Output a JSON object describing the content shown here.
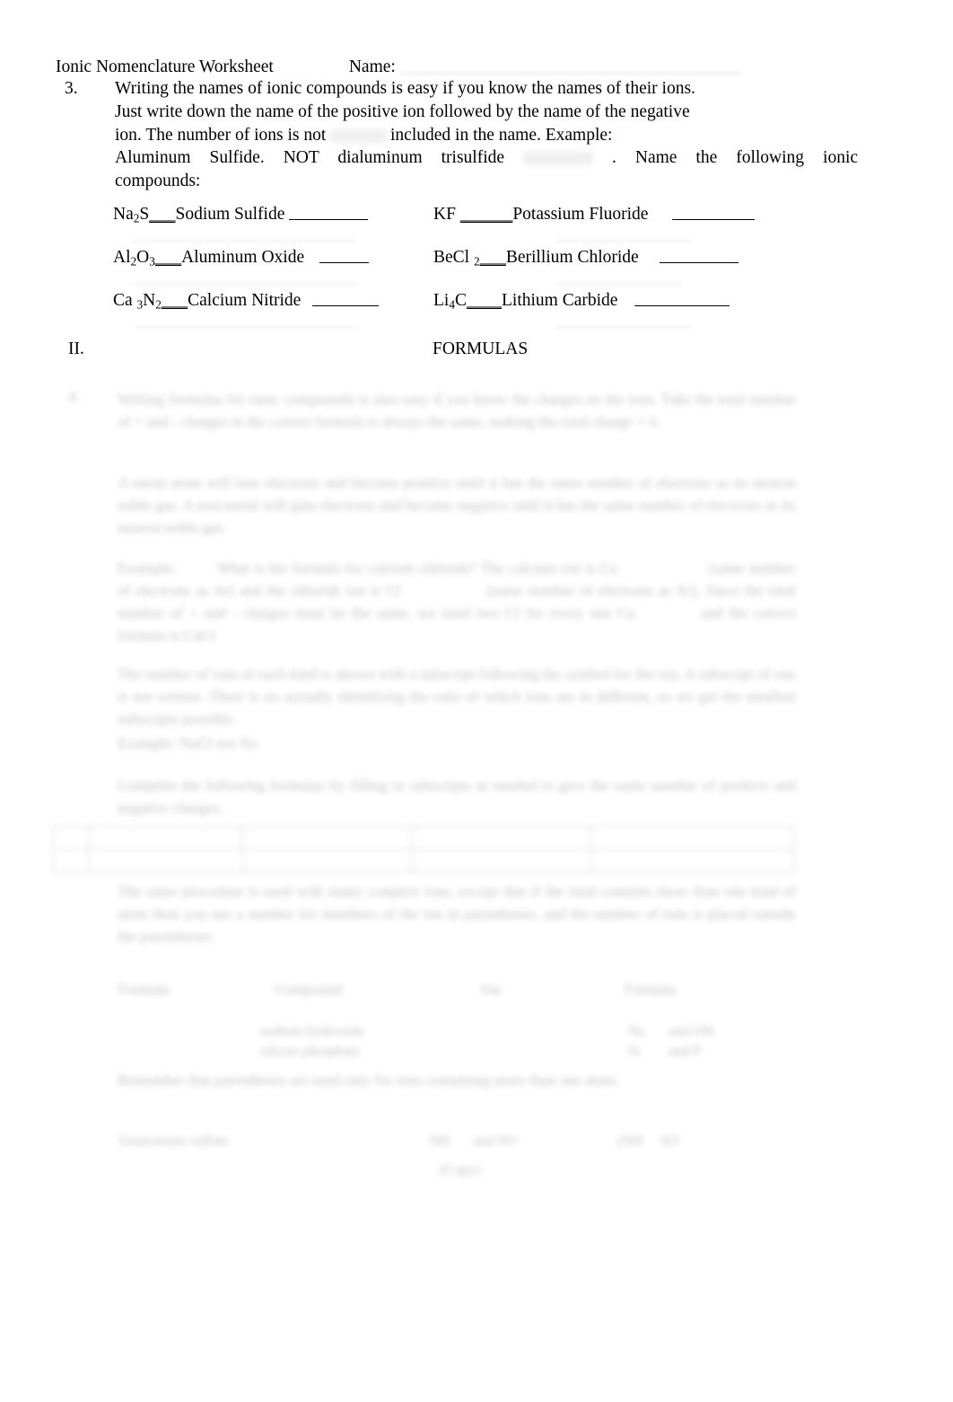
{
  "document": {
    "header": {
      "title": "Ionic Nomenclature Worksheet",
      "name_label": "Name:"
    },
    "item3": {
      "number": "3.",
      "line1": "Writing the names of ionic compounds is easy if you know the names of their ions.",
      "line2": "Just write down the name of the positive ion followed by the name of the negative",
      "line3_a": "ion. The number of ions is not",
      "line3_b": "included in the name. Example:",
      "line4_a": "Aluminum Sulfide.",
      "line4_b": "NOT dialuminum trisulfide",
      "line4_c": ".",
      "line4_d": "Name the following ionic",
      "line5": "compounds:"
    },
    "compounds": {
      "rows": [
        {
          "left": {
            "formula_pre": "Na",
            "formula_sub": "2",
            "formula_post": "S",
            "separator": "___",
            "name": "Sodium Sulfide",
            "blank_width": 88
          },
          "right": {
            "formula_pre": "KF",
            "formula_sub": "",
            "formula_post": "",
            "separator": "______",
            "name": "Potassium Fluoride",
            "blank_width": 92
          }
        },
        {
          "left": {
            "formula_pre": "Al",
            "formula_sub": "2",
            "formula_post": "O",
            "formula_sub2": "3",
            "separator": "___",
            "name": "Aluminum Oxide",
            "blank_width": 55
          },
          "right": {
            "formula_pre": "BeCl",
            "formula_sub": "2",
            "formula_post": "",
            "separator": "___",
            "name": "Berillium Chloride",
            "blank_width": 88
          }
        },
        {
          "left": {
            "formula_pre": "Ca",
            "formula_sub": "3",
            "formula_post": "N",
            "formula_sub2": "2",
            "separator": "___",
            "name": "Calcium Nitride",
            "blank_width": 74
          },
          "right": {
            "formula_pre": "Li",
            "formula_sub": "4",
            "formula_post": "C",
            "separator": "____",
            "name": "Lithium Carbide",
            "blank_width": 106
          }
        }
      ]
    },
    "section2": {
      "numeral": "II.",
      "title": "FORMULAS"
    },
    "obscured": {
      "note": "lower portion of page is blurred and illegible",
      "item_number": "4.",
      "paragraph1": "Writing formulas for ionic compounds is also easy if you know the charges on the ions. Take the total number of + and - charges in the correct formula is always the same, making the total charge = 0.",
      "paragraph2": "A metal atom will lose electrons and become positive until it has the same number of electrons as its nearest noble gas. A non-metal will gain electrons and become negative until it has the same number of electrons as its nearest noble gas.",
      "paragraph3_a": "Example:",
      "paragraph3_b": "What is the formula for calcium chloride? The calcium ion is Ca",
      "paragraph3_c": "(same number of electrons as Ar) and the chloride ion is Cl",
      "paragraph3_d": "(same number of electrons as Ar). Since the total number of + and - charges must be the same, we need two Cl for every one Ca",
      "paragraph3_e": "and the correct formula is CaCl",
      "paragraph4": "The number of ions of each kind is shown with a subscript following the symbol for the ion. A subscript of one is not written. There is no actually identifying the ratio of which ions are in different, so we get the smallest subscripts possible.",
      "paragraph4_b": "Example:      NaCl      not Na",
      "paragraph5": "Complete the following formulas by filling in subscripts as needed to give the same number of positive and negative charges.",
      "paragraph6": "The same procedure is used with many complex ions, except that if the total contains more than one kind of atom then you use a number for members of the ion in parentheses, and the number of ions is placed outside the parentheses.",
      "columns": [
        "Formula",
        "Compound",
        "Ion",
        "Formula"
      ],
      "cell_values": [
        "sodium hydroxide",
        "silicon phosphate",
        "Na",
        "and OH",
        "Si",
        "and P"
      ],
      "paragraph7": "Remember that parentheses are used only for ions containing more than one atom.",
      "last_row_a": "Ammonium sulfate",
      "last_row_b": "NH",
      "last_row_c": "and SO",
      "last_row_d": "(NH",
      "last_row_e": ")",
      "last_row_f": "SO",
      "footer": "(Copy)"
    }
  }
}
